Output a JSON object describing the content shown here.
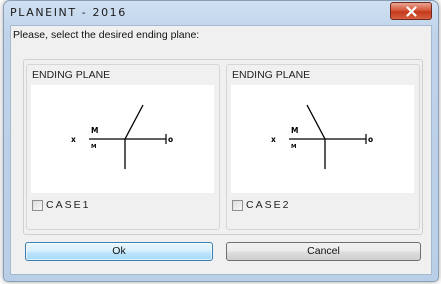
{
  "window": {
    "title": "PLANEINT - 2016",
    "close_icon": "close-icon"
  },
  "prompt": "Please, select the desired ending plane:",
  "cases": [
    {
      "panel_title": "ENDING PLANE",
      "checkbox_label": "CASE1",
      "checked": false,
      "diagram": {
        "left_label": "x",
        "mid_label_top": "M",
        "mid_label_bottom": "M",
        "right_label": "o"
      }
    },
    {
      "panel_title": "ENDING PLANE",
      "checkbox_label": "CASE2",
      "checked": false,
      "diagram": {
        "left_label": "x",
        "mid_label_top": "M",
        "mid_label_bottom": "M",
        "right_label": "o"
      }
    }
  ],
  "buttons": {
    "ok_label": "Ok",
    "cancel_label": "Cancel"
  },
  "colors": {
    "frame": "#bfd3ea",
    "client_bg": "#f0f0f0",
    "close_button": "#c5391b",
    "default_button_border": "#3c7fb1"
  }
}
